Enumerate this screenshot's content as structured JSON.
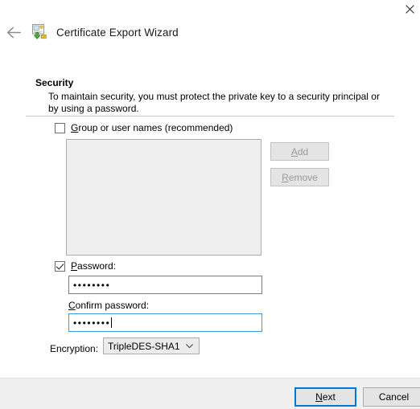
{
  "window": {
    "title": "Certificate Export Wizard",
    "close_label": "×",
    "back_label": "←",
    "icon": "certificate-export-icon"
  },
  "page": {
    "section_title": "Security",
    "section_description": "To maintain security, you must protect the private key to a security principal or by using a password."
  },
  "group_users": {
    "checkbox_label_pre": "G",
    "checkbox_label_post": "roup or user names (recommended)",
    "checked": false,
    "add_button": {
      "pre": "A",
      "post": "dd",
      "enabled": false
    },
    "remove_button": {
      "pre": "R",
      "post": "emove",
      "enabled": false
    },
    "list_items": []
  },
  "password_section": {
    "checkbox_label_pre": "P",
    "checkbox_label_post": "assword:",
    "checked": true,
    "password_value": "••••••••",
    "confirm_label_pre": "C",
    "confirm_label_post": "onfirm password:",
    "confirm_value": "••••••••",
    "confirm_focused": true
  },
  "encryption": {
    "label": "Encryption:",
    "selected": "TripleDES-SHA1",
    "options": [
      "TripleDES-SHA1"
    ]
  },
  "footer": {
    "next_pre": "N",
    "next_post": "ext",
    "cancel_label": "Cancel"
  },
  "colors": {
    "accent": "#0078d7",
    "focus_border": "#3d9ae2",
    "footer_bg": "#f0f0f0",
    "disabled_text": "#9a9a9a"
  }
}
